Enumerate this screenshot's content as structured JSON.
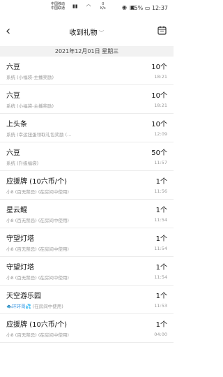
{
  "status": {
    "carrier1": "中国移动",
    "carrier2": "中国联通",
    "speed_value": "0",
    "speed_unit": "K/s",
    "battery": "85%",
    "time": "12:37"
  },
  "header": {
    "title": "收到礼物",
    "back_icon": "chevron-left-icon",
    "calendar_icon": "calendar-icon"
  },
  "date_bar": "2021年12月01日 星期三",
  "items": [
    {
      "name": "六豆",
      "sub": "系统 (小福袋-主播奖励)",
      "count": "10个",
      "time": "18:21"
    },
    {
      "name": "六豆",
      "sub": "系统 (小福袋-主播奖励)",
      "count": "10个",
      "time": "18:21"
    },
    {
      "name": "上头条",
      "sub": "系统 (幸运扭蛋领取礼包奖励 (...",
      "count": "10个",
      "time": "12:09"
    },
    {
      "name": "六豆",
      "sub": "系统 (升级福袋)",
      "count": "50个",
      "time": "11:57"
    },
    {
      "name": "应援牌 (10六币/个)",
      "sub": "小8 (百无禁忌) (在房间中使用)",
      "count": "1个",
      "time": "11:56"
    },
    {
      "name": "星云鲲",
      "sub": "小8 (百无禁忌) (在房间中使用)",
      "count": "1个",
      "time": "11:54"
    },
    {
      "name": "守望灯塔",
      "sub": "小8 (百无禁忌) (在房间中使用)",
      "count": "1个",
      "time": "11:54"
    },
    {
      "name": "守望灯塔",
      "sub": "小8 (百无禁忌) (在房间中使用)",
      "count": "1个",
      "time": "11:54"
    },
    {
      "name": "天空游乐园",
      "sub_prefix": "环环哥",
      "sub_suffix": " (在房间中使用)",
      "count": "1个",
      "time": "11:53"
    },
    {
      "name": "应援牌 (10六币/个)",
      "sub": "小8 (百无禁忌) (在房间中使用)",
      "count": "1个",
      "time": "04:00"
    }
  ]
}
